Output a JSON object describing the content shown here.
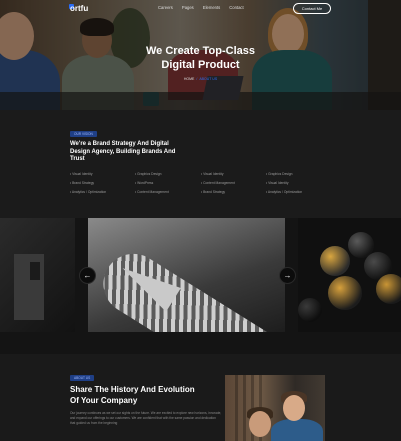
{
  "brand": {
    "logo": "ortfu",
    "accent": "#2b6cf5"
  },
  "nav": {
    "links": [
      "Careers",
      "Pages",
      "Elements",
      "Contact"
    ],
    "cta": "Contact Me"
  },
  "hero": {
    "title_line1": "We Create Top-Class",
    "title_line2": "Digital Product",
    "breadcrumb_home": "HOME",
    "breadcrumb_sep": "/",
    "breadcrumb_current": "ABOUT US"
  },
  "services": {
    "tag": "OUR VISION",
    "heading_line1": "We're a Brand Strategy And Digital",
    "heading_line2": "Design Agency, Building Brands And",
    "heading_line3": "Trust",
    "columns": [
      [
        "Visual Identity",
        "Brand Strategy",
        "Analytics / Optimization"
      ],
      [
        "Graphics Design",
        "WordPress",
        "Content Management"
      ],
      [
        "Visual Identity",
        "Content Management",
        "Brand Strategy"
      ],
      [
        "Graphics Design",
        "Visual Identity",
        "Analytics / Optimization"
      ]
    ]
  },
  "carousel": {
    "prev_icon": "arrow-left-icon",
    "next_icon": "arrow-right-icon",
    "prev_glyph": "←",
    "next_glyph": "→"
  },
  "history": {
    "tag": "ABOUT US",
    "heading_line1": "Share The History And Evolution",
    "heading_line2": "Of Your Company",
    "paragraph": "Our journey continues as we set our sights on the future. We are excited to explore new horizons, innovate, and expand our offerings to our customers. We are confident that with the same passion and dedication that guided us from the beginning"
  }
}
